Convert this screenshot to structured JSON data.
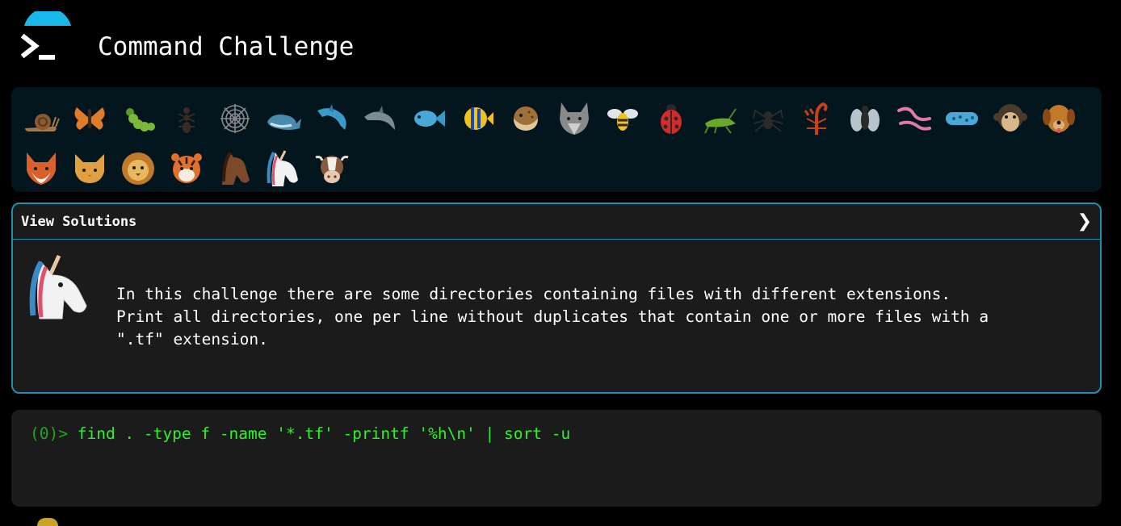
{
  "header": {
    "title": "Command Challenge",
    "logo_icon": "terminal-prompt-icon",
    "logo_accent": "#19b8ea"
  },
  "levels": [
    {
      "name": "snail",
      "icon": "snail-icon"
    },
    {
      "name": "butterfly",
      "icon": "butterfly-icon"
    },
    {
      "name": "caterpillar",
      "icon": "caterpillar-icon"
    },
    {
      "name": "ant",
      "icon": "ant-icon"
    },
    {
      "name": "spider-web",
      "icon": "spider-web-icon"
    },
    {
      "name": "whale",
      "icon": "whale-icon"
    },
    {
      "name": "dolphin",
      "icon": "dolphin-icon"
    },
    {
      "name": "dolphin-2",
      "icon": "dolphin-icon"
    },
    {
      "name": "fish",
      "icon": "fish-icon"
    },
    {
      "name": "tropical-fish",
      "icon": "tropical-fish-icon"
    },
    {
      "name": "blowfish",
      "icon": "blowfish-icon"
    },
    {
      "name": "wolf",
      "icon": "wolf-icon"
    },
    {
      "name": "bee",
      "icon": "bee-icon"
    },
    {
      "name": "ladybug",
      "icon": "ladybug-icon"
    },
    {
      "name": "cricket",
      "icon": "cricket-icon"
    },
    {
      "name": "spider",
      "icon": "spider-icon"
    },
    {
      "name": "scorpion",
      "icon": "scorpion-icon"
    },
    {
      "name": "fly",
      "icon": "fly-icon"
    },
    {
      "name": "worm",
      "icon": "worm-icon"
    },
    {
      "name": "microbe",
      "icon": "microbe-icon"
    },
    {
      "name": "monkey",
      "icon": "monkey-icon"
    },
    {
      "name": "dog",
      "icon": "dog-icon"
    },
    {
      "name": "fox",
      "icon": "fox-icon"
    },
    {
      "name": "cat",
      "icon": "cat-icon"
    },
    {
      "name": "lion",
      "icon": "lion-icon"
    },
    {
      "name": "tiger",
      "icon": "tiger-icon"
    },
    {
      "name": "horse",
      "icon": "horse-icon"
    },
    {
      "name": "unicorn",
      "icon": "unicorn-icon"
    },
    {
      "name": "cow",
      "icon": "cow-icon"
    }
  ],
  "solutions": {
    "label": "View Solutions",
    "toggle_icon": "chevron-right-icon",
    "border_color": "#1f8fb0"
  },
  "challenge": {
    "avatar_icon": "unicorn-icon",
    "description": "In this challenge there are some directories containing files with different extensions.\nPrint all directories, one per line without duplicates that contain one or more files with a\n\".tf\" extension."
  },
  "terminal": {
    "prompt": "(0)>",
    "command": "find . -type f -name '*.tf' -printf '%h\\n' | sort -u",
    "prompt_color": "#1da81d",
    "command_color": "#2cf22c"
  }
}
